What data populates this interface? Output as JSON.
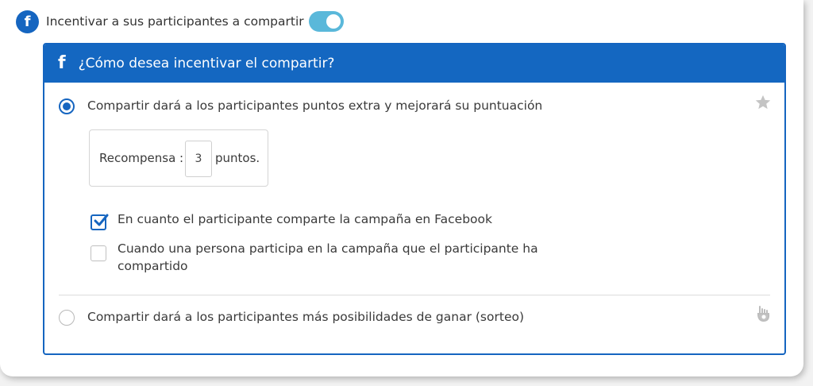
{
  "top": {
    "icon": "facebook-icon",
    "label": "Incentivar a sus participantes a compartir",
    "toggle_on": true,
    "toggle_color": "#5ab8da"
  },
  "panel": {
    "header_icon": "facebook-f-icon",
    "header_title": "¿Cómo desea incentivar el compartir?",
    "header_color": "#1467c1",
    "option1": {
      "label": "Compartir dará a los participantes puntos extra y mejorará su puntuación",
      "selected": true,
      "icon": "star-icon"
    },
    "reward": {
      "label": "Recompensa :",
      "value": "3",
      "unit": "puntos."
    },
    "checkboxes": [
      {
        "label": "En cuanto el participante comparte la campaña en Facebook",
        "checked": true
      },
      {
        "label_line1": "Cuando una persona participa en la campaña que el participante ha",
        "label_line2": "compartido",
        "checked": false
      }
    ],
    "option2": {
      "label": "Compartir dará a los participantes más posibilidades de ganar (sorteo)",
      "selected": false,
      "icon": "hand-icon"
    }
  }
}
